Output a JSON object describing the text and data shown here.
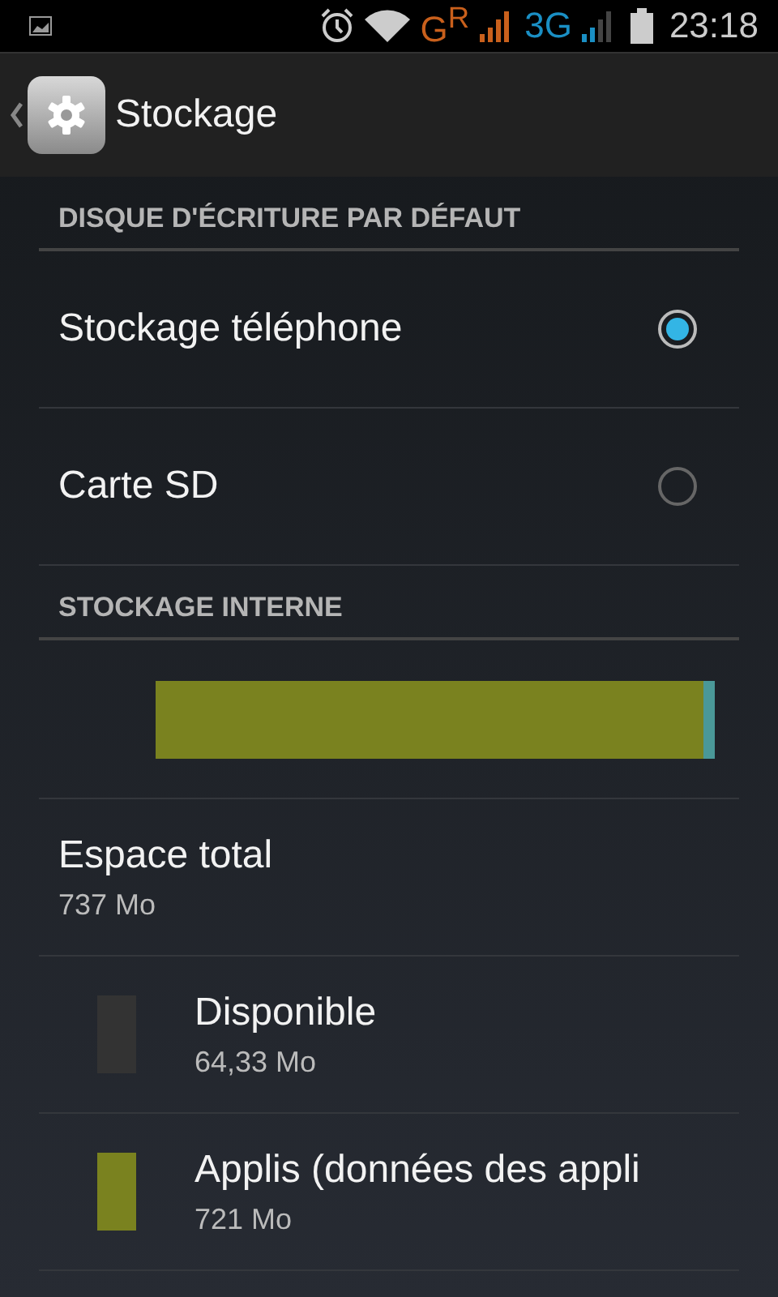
{
  "status_bar": {
    "network_1": "G$^{R}$",
    "network_2": "3G",
    "time": "23:18"
  },
  "action_bar": {
    "title": "Stockage"
  },
  "sections": [
    {
      "header": "DISQUE D'ÉCRITURE PAR DÉFAUT",
      "kind": "radios",
      "options": [
        {
          "label": "Stockage téléphone",
          "selected": true
        },
        {
          "label": "Carte SD",
          "selected": false
        }
      ]
    },
    {
      "header": "STOCKAGE INTERNE",
      "kind": "usage",
      "bar": {
        "level": 0.98
      },
      "total": {
        "label": "Espace total",
        "value": "737 Mo"
      },
      "items": [
        {
          "label": "Disponible",
          "value": "64,33 Mo",
          "color": "#333333"
        },
        {
          "label": "Applis (données des appli",
          "value": "721 Mo",
          "color": "#7a821f"
        }
      ]
    }
  ]
}
